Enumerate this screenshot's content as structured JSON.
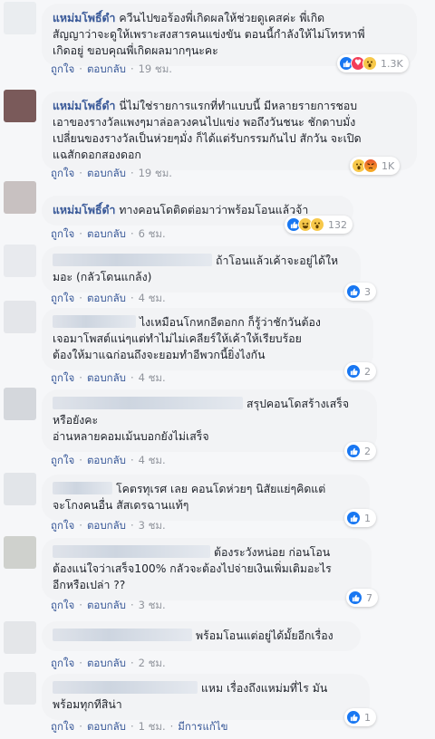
{
  "labels": {
    "like": "ถูกใจ",
    "reply": "ตอบกลับ",
    "edited": "มีการแก้ไข"
  },
  "comments": [
    {
      "author": "แหม่มโพธิ์ดำ",
      "lines": [
        "ควีนไปขอร้องพี่เกิดผลให้ช่วยดูเคสค่ะ พี่เกิด",
        "สัญญาว่าจะดูให้เพราะสงสารคนแข่งขัน ตอนนี้กำลังให้ไม่โทรหาพี่",
        "เกิดอยู่ ขอบคุณพี่เกิดผลมากๆนะคะ"
      ],
      "time": "19 ชม.",
      "reaction_icons": [
        "like-icon",
        "love-icon",
        "wow-icon"
      ],
      "reaction_count": "1.3K"
    },
    {
      "author": "แหม่มโพธิ์ดำ",
      "lines": [
        "นี่ไม่ใช่รายการแรกที่ทำแบบนี้ มีหลายรายการชอบ",
        "เอาของรางวัลแพงๆมาล่อลวงคนไปแข่ง พอถึงวันชนะ ชักดาบมั่ง",
        "เปลี่ยนของรางวัลเป็นห่วยๆมั่ง ก็ได้แต่รับกรรมกันไป สักวัน จะเปิด",
        "แฉสักดอกสองดอก"
      ],
      "time": "19 ชม.",
      "reaction_icons": [
        "wow-icon",
        "angry-icon"
      ],
      "reaction_count": "1K"
    },
    {
      "author": "แหม่มโพธิ์ดำ",
      "lines": [
        "ทางคอนโดติดต่อมาว่าพร้อมโอนแล้วจ้า"
      ],
      "time": "6 ชม.",
      "reaction_icons": [
        "like-icon",
        "haha-icon",
        "wow-icon"
      ],
      "reaction_count": "132"
    },
    {
      "lines": [
        "ถ้าโอนแล้วเค้าจะอยู่ได้ให",
        "มอะ (กลัวโดนแกล้ง)"
      ],
      "time": "4 ชม.",
      "reaction_icons": [
        "like-icon"
      ],
      "reaction_count": "3"
    },
    {
      "lines": [
        "ไงเหมือนโกหกอีตอกก ก็รู้ว่าชักวันต้อง",
        "เจอมาโพสต์แน่ๆแต่ทำไม่ไม่เคลียร์ให้เค้าให้เรียบร้อย",
        "ต้องให้มาแฉก่อนถึงจะยอมทำอีพวกนี้ยิ่งไงกัน"
      ],
      "time": "4 ชม.",
      "reaction_icons": [
        "like-icon"
      ],
      "reaction_count": "2"
    },
    {
      "lines": [
        "สรุปคอนโดสร้างเสร็จ",
        "หรือยังคะ",
        "อ่านหลายคอมเม้นบอกยังไม่เสร็จ"
      ],
      "time": "4 ชม.",
      "reaction_icons": [
        "like-icon"
      ],
      "reaction_count": "2"
    },
    {
      "lines": [
        "โคตรทุเรศ เลย คอนโดห่วยๆ นิสัยแย่ๆคิดแต่",
        "จะโกงคนอื่น สัสเดรฉานแท้ๆ"
      ],
      "time": "3 ชม.",
      "reaction_icons": [
        "like-icon"
      ],
      "reaction_count": "1"
    },
    {
      "lines": [
        "ต้องระวังหน่อย ก่อนโอน",
        "ต้องแน่ใจว่าเสร็จ100% กลัวจะต้องไปจ่ายเงินเพิ่มเติมอะไร",
        "อีกหรือเปล่า ??"
      ],
      "time": "3 ชม.",
      "reaction_icons": [
        "like-icon"
      ],
      "reaction_count": "7"
    },
    {
      "lines": [
        "พร้อมโอนแต่อยู่ได้มั้ยอีกเรื่อง"
      ],
      "time": "2 ชม.",
      "reaction_icons": [],
      "reaction_count": ""
    },
    {
      "lines": [
        "แหม เรื่องถึงแหม่มที่ไร มัน",
        "พร้อมทุกทีสิน่า"
      ],
      "time": "1 ชม.",
      "edited": true,
      "reaction_icons": [
        "like-icon"
      ],
      "reaction_count": "1"
    }
  ]
}
